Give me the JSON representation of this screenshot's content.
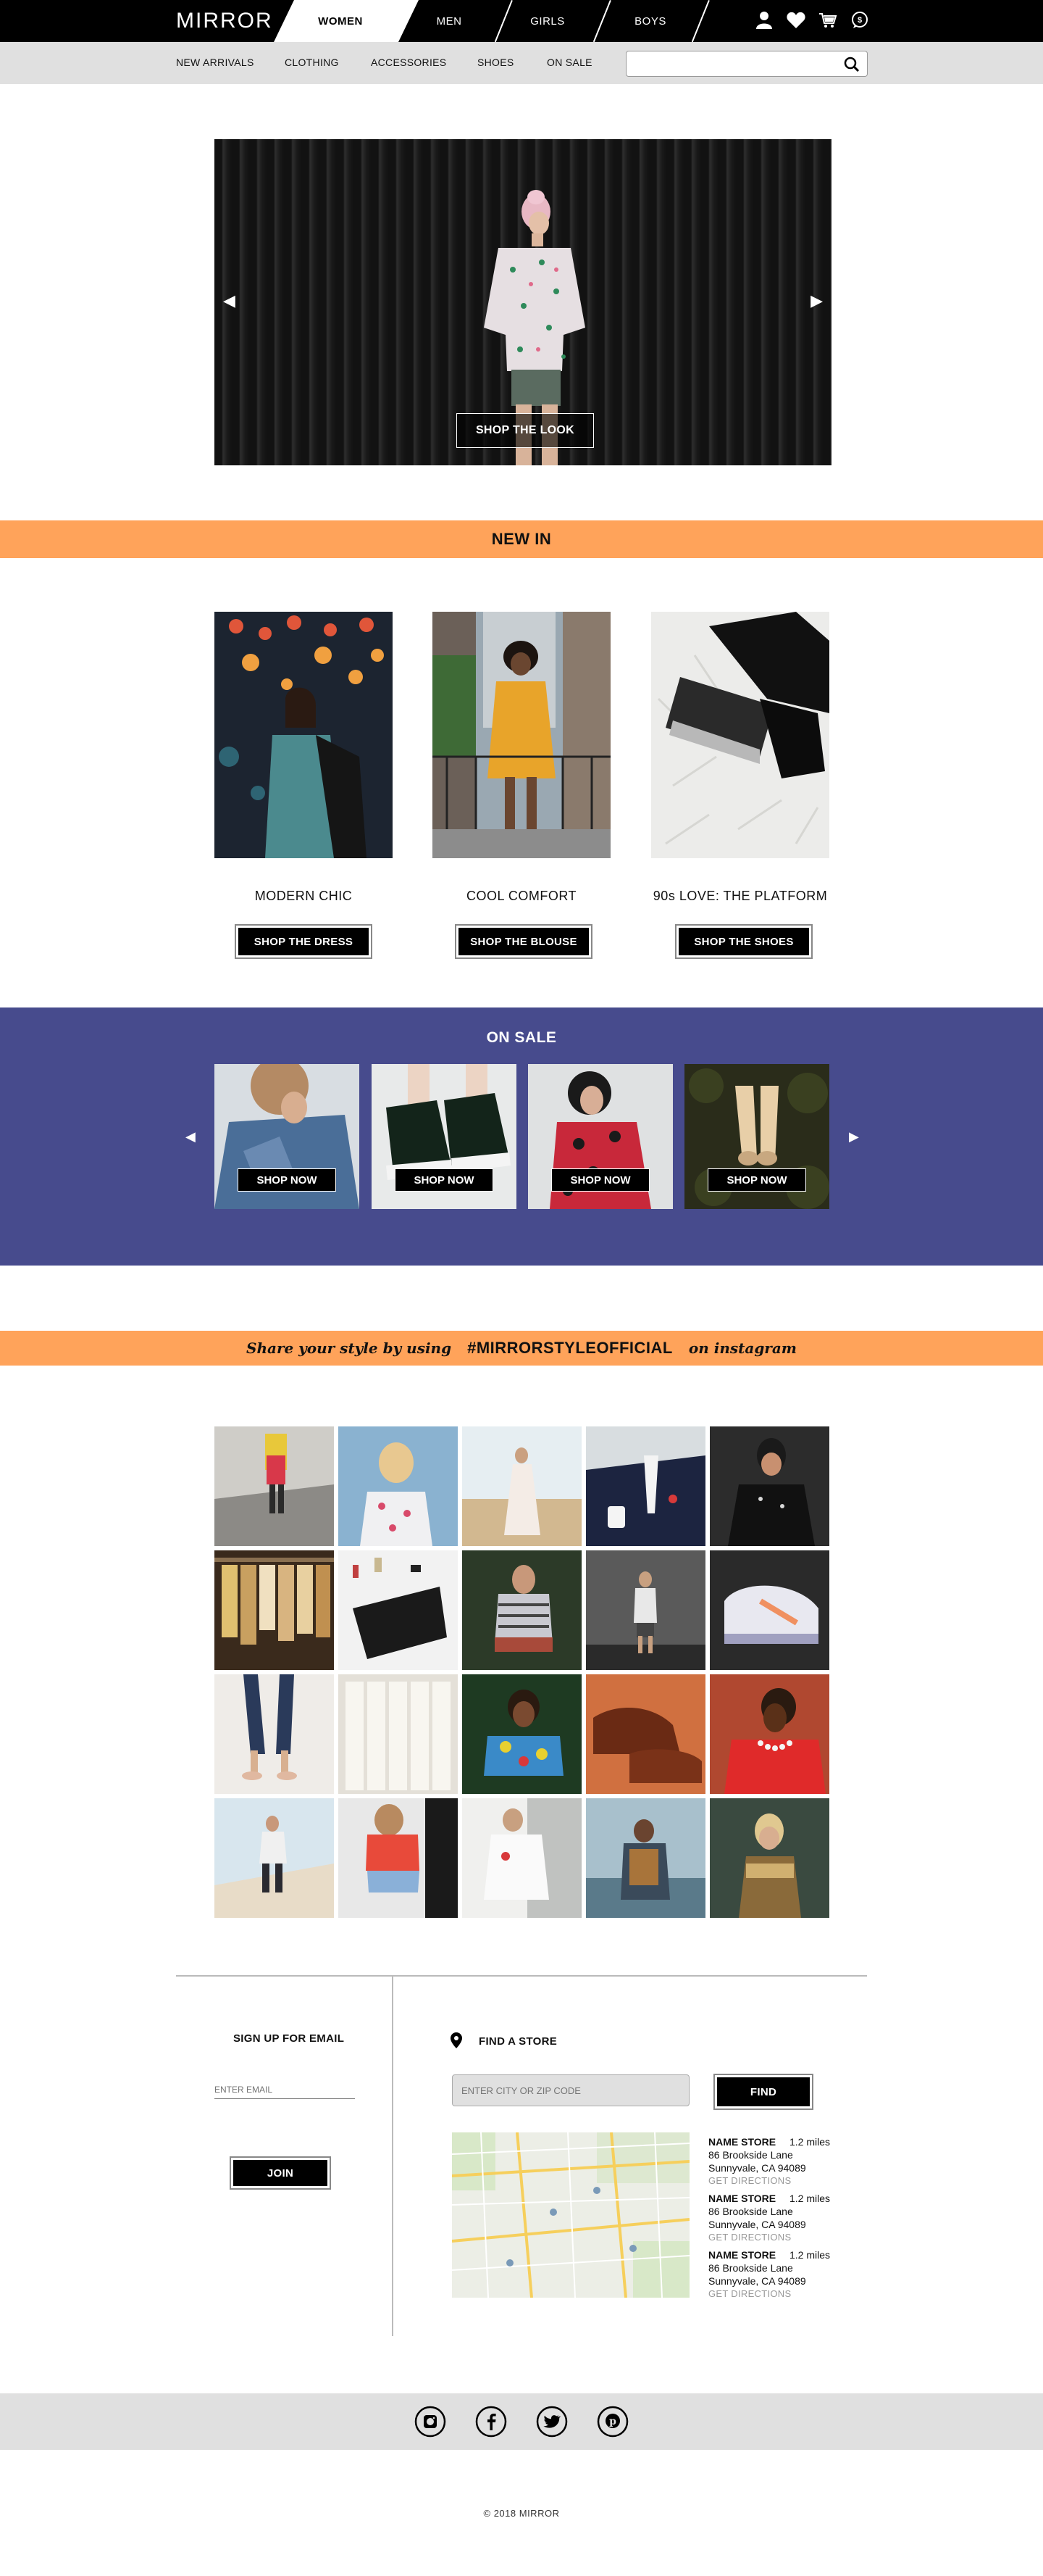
{
  "brand": {
    "logo": "MIRROR"
  },
  "top_nav": {
    "tabs": [
      {
        "label": "WOMEN",
        "active": true
      },
      {
        "label": "MEN"
      },
      {
        "label": "GIRLS"
      },
      {
        "label": "BOYS"
      }
    ],
    "icons": [
      "user-icon",
      "heart-icon",
      "cart-icon",
      "chat-icon"
    ]
  },
  "sub_nav": {
    "items": [
      "NEW ARRIVALS",
      "CLOTHING",
      "ACCESSORIES",
      "SHOES",
      "ON SALE"
    ],
    "search": {
      "value": "",
      "placeholder": ""
    }
  },
  "hero": {
    "button": "SHOP THE LOOK"
  },
  "new_in": {
    "title": "NEW IN",
    "items": [
      {
        "name": "MODERN CHIC",
        "button": "SHOP THE DRESS"
      },
      {
        "name": "COOL COMFORT",
        "button": "SHOP THE BLOUSE"
      },
      {
        "name": "90s LOVE: THE PLATFORM",
        "button": "SHOP THE SHOES"
      }
    ]
  },
  "on_sale": {
    "title": "ON SALE",
    "items": [
      {
        "button": "SHOP NOW"
      },
      {
        "button": "SHOP NOW"
      },
      {
        "button": "SHOP NOW"
      },
      {
        "button": "SHOP NOW"
      }
    ]
  },
  "instagram": {
    "prefix": "Share your style by using",
    "hashtag": "#MIRRORSTYLEOFFICIAL",
    "suffix": "on instagram"
  },
  "signup": {
    "title": "SIGN UP FOR EMAIL",
    "placeholder": "ENTER EMAIL",
    "button": "JOIN"
  },
  "store_finder": {
    "title": "FIND A STORE",
    "placeholder": "ENTER CITY OR ZIP CODE",
    "button": "FIND",
    "stores": [
      {
        "name": "NAME STORE",
        "distance": "1.2 miles",
        "address1": "86 Brookside Lane",
        "address2": "Sunnyvale, CA 94089",
        "link": "GET DIRECTIONS"
      },
      {
        "name": "NAME STORE",
        "distance": "1.2 miles",
        "address1": "86 Brookside Lane",
        "address2": "Sunnyvale, CA 94089",
        "link": "GET DIRECTIONS"
      },
      {
        "name": "NAME STORE",
        "distance": "1.2 miles",
        "address1": "86 Brookside Lane",
        "address2": "Sunnyvale, CA 94089",
        "link": "GET DIRECTIONS"
      }
    ]
  },
  "social": [
    "instagram-icon",
    "facebook-icon",
    "twitter-icon",
    "pinterest-icon"
  ],
  "footer": {
    "copyright": "© 2018 MIRROR"
  },
  "colors": {
    "accent_orange": "#ffa35a",
    "sale_blue": "#474b8d",
    "nav_black": "#000000",
    "subnav_gray": "#e0e0e0"
  }
}
